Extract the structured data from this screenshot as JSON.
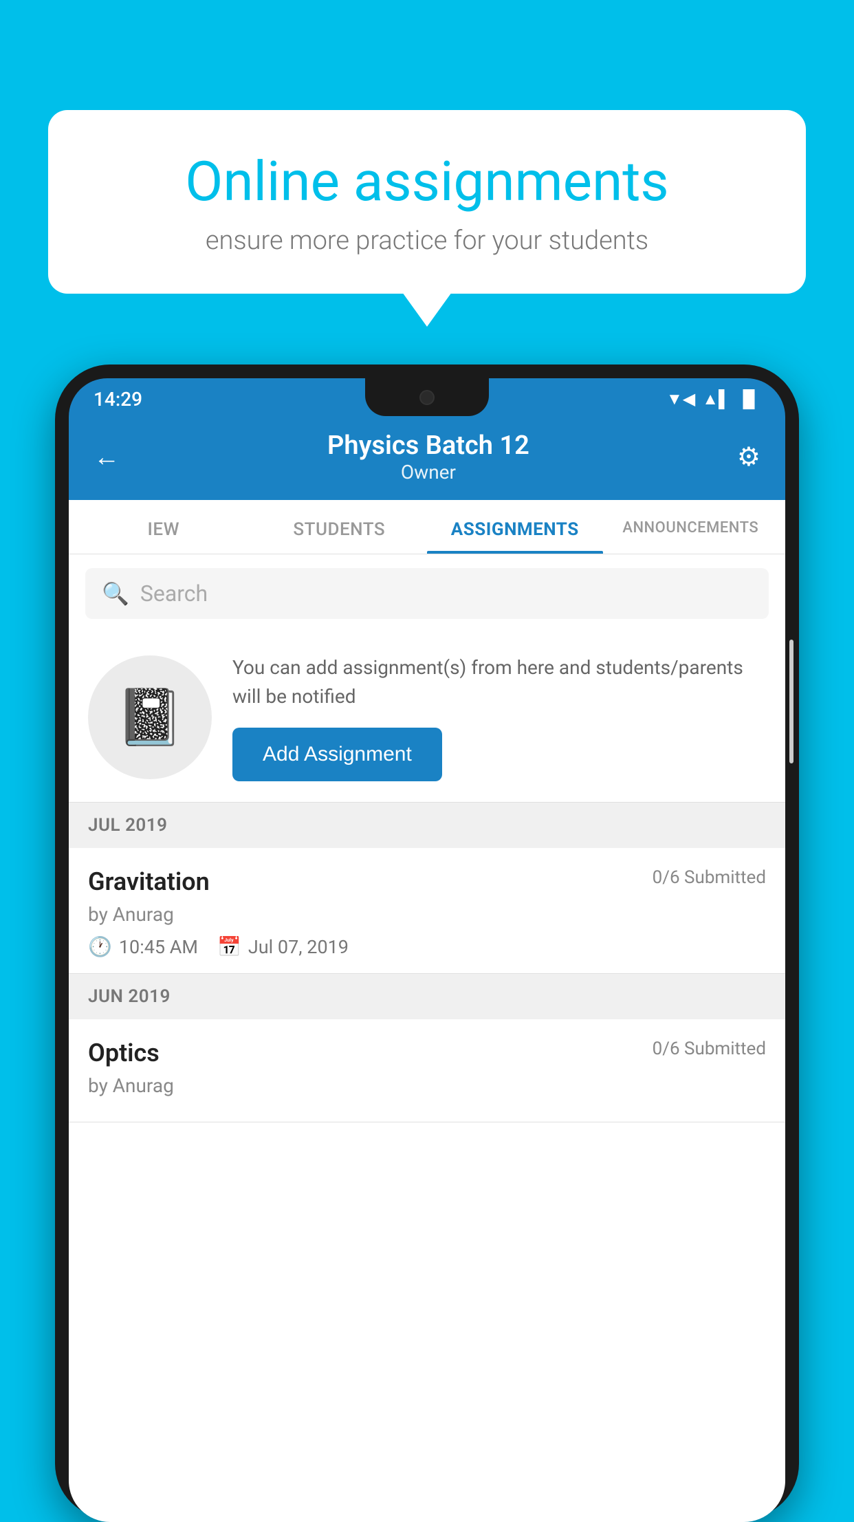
{
  "background_color": "#00BFEA",
  "bubble": {
    "title": "Online assignments",
    "subtitle": "ensure more practice for your students"
  },
  "phone": {
    "status_bar": {
      "time": "14:29",
      "wifi": "▼",
      "signal": "▲",
      "battery": "▐"
    },
    "header": {
      "title": "Physics Batch 12",
      "subtitle": "Owner",
      "back_label": "←",
      "settings_label": "⚙"
    },
    "tabs": [
      {
        "id": "iew",
        "label": "IEW",
        "active": false
      },
      {
        "id": "students",
        "label": "STUDENTS",
        "active": false
      },
      {
        "id": "assignments",
        "label": "ASSIGNMENTS",
        "active": true
      },
      {
        "id": "announcements",
        "label": "ANNOUNCEMENTS",
        "active": false
      }
    ],
    "search": {
      "placeholder": "Search"
    },
    "info": {
      "text": "You can add assignment(s) from here and students/parents will be notified",
      "button_label": "Add Assignment"
    },
    "month_sections": [
      {
        "label": "JUL 2019",
        "assignments": [
          {
            "title": "Gravitation",
            "submitted": "0/6 Submitted",
            "author": "by Anurag",
            "time": "10:45 AM",
            "date": "Jul 07, 2019"
          }
        ]
      },
      {
        "label": "JUN 2019",
        "assignments": [
          {
            "title": "Optics",
            "submitted": "0/6 Submitted",
            "author": "by Anurag",
            "time": "",
            "date": ""
          }
        ]
      }
    ]
  }
}
